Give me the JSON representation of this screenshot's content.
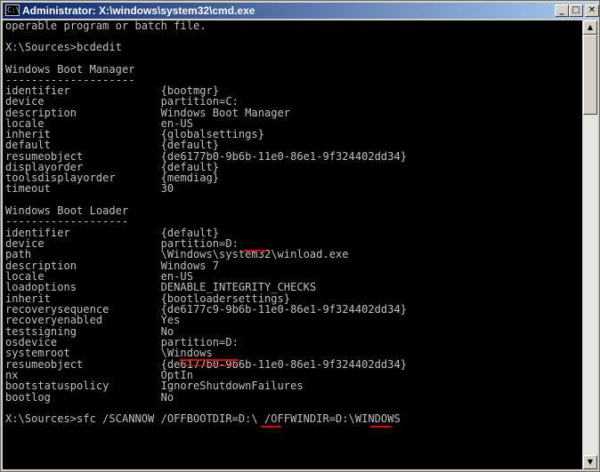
{
  "window": {
    "title": "Administrator: X:\\windows\\system32\\cmd.exe",
    "icon_label": "C:\\",
    "minimize_glyph": "_",
    "maximize_glyph": "□",
    "close_glyph": "✕"
  },
  "scrollbar": {
    "up_glyph": "▲",
    "down_glyph": "▼"
  },
  "console": {
    "lines": [
      "operable program or batch file.",
      "",
      "X:\\Sources>bcdedit",
      "",
      "Windows Boot Manager",
      "--------------------",
      "identifier              {bootmgr}",
      "device                  partition=C:",
      "description             Windows Boot Manager",
      "locale                  en-US",
      "inherit                 {globalsettings}",
      "default                 {default}",
      "resumeobject            {de6177b0-9b6b-11e0-86e1-9f324402dd34}",
      "displayorder            {default}",
      "toolsdisplayorder       {memdiag}",
      "timeout                 30",
      "",
      "Windows Boot Loader",
      "-------------------",
      "identifier              {default}",
      "device                  partition=D:",
      "path                    \\Windows\\system32\\winload.exe",
      "description             Windows 7",
      "locale                  en-US",
      "loadoptions             DENABLE_INTEGRITY_CHECKS",
      "inherit                 {bootloadersettings}",
      "recoverysequence        {de6177c9-9b6b-11e0-86e1-9f324402dd34}",
      "recoveryenabled         Yes",
      "testsigning             No",
      "osdevice                partition=D:",
      "systemroot              \\Windows",
      "resumeobject            {de6177b0-9b6b-11e0-86e1-9f324402dd34}",
      "nx                      OptIn",
      "bootstatuspolicy        IgnoreShutdownFailures",
      "bootlog                 No",
      "",
      "",
      "X:\\Sources>sfc /SCANNOW /OFFBOOTDIR=D:\\ /OFFWINDIR=D:\\WINDOWS"
    ]
  },
  "annotation_color": "#e60000"
}
